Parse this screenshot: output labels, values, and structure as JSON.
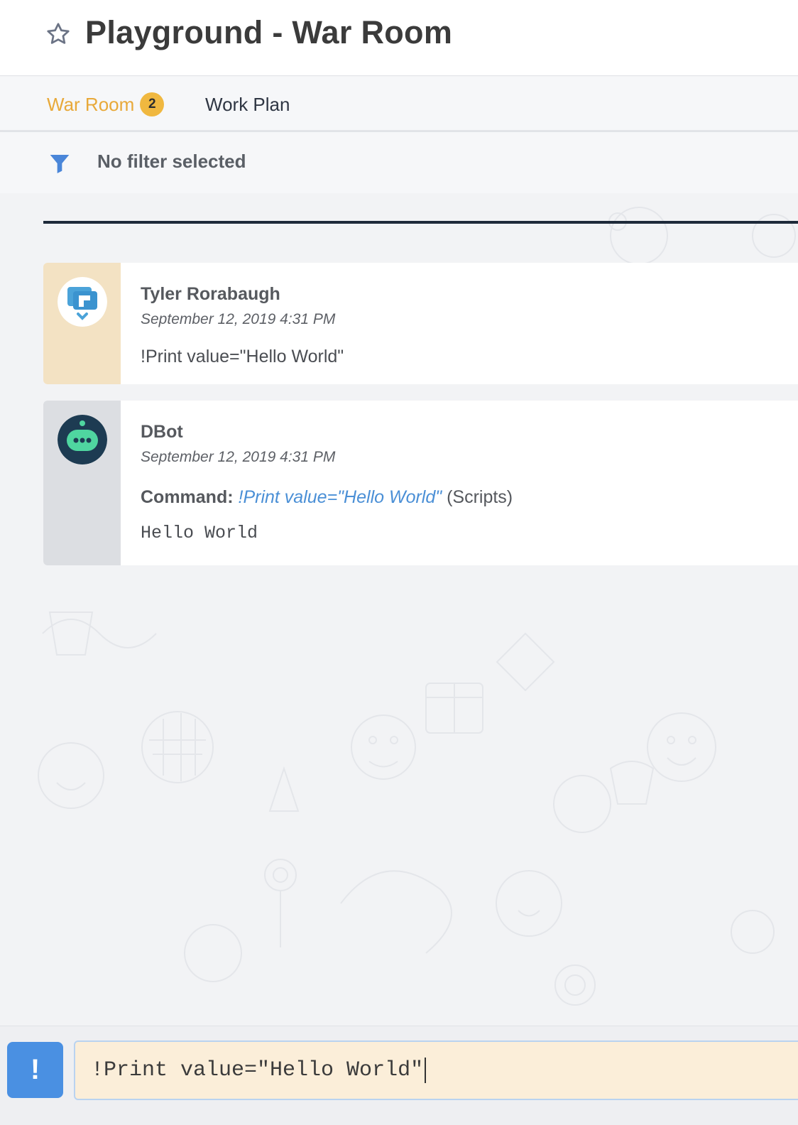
{
  "header": {
    "title": "Playground - War Room",
    "star_icon": "star-outline-icon"
  },
  "tabs": [
    {
      "label": "War Room",
      "badge": "2",
      "active": true
    },
    {
      "label": "Work Plan",
      "active": false
    }
  ],
  "filter": {
    "icon": "filter-icon",
    "text": "No filter selected"
  },
  "entries": [
    {
      "author": "Tyler Rorabaugh",
      "timestamp": "September 12, 2019 4:31 PM",
      "message": "!Print value=\"Hello World\"",
      "avatar": "chat-user-icon"
    },
    {
      "author": "DBot",
      "timestamp": "September 12, 2019 4:31 PM",
      "command_label": "Command:",
      "command_text": "!Print value=\"Hello World\"",
      "command_source": "(Scripts)",
      "output": "Hello World",
      "avatar": "bot-icon"
    }
  ],
  "input": {
    "mode_button": "!",
    "value": "!Print value=\"Hello World\""
  },
  "colors": {
    "accent": "#e8a93a",
    "link": "#4a8fd6",
    "button": "#4a90e2"
  }
}
